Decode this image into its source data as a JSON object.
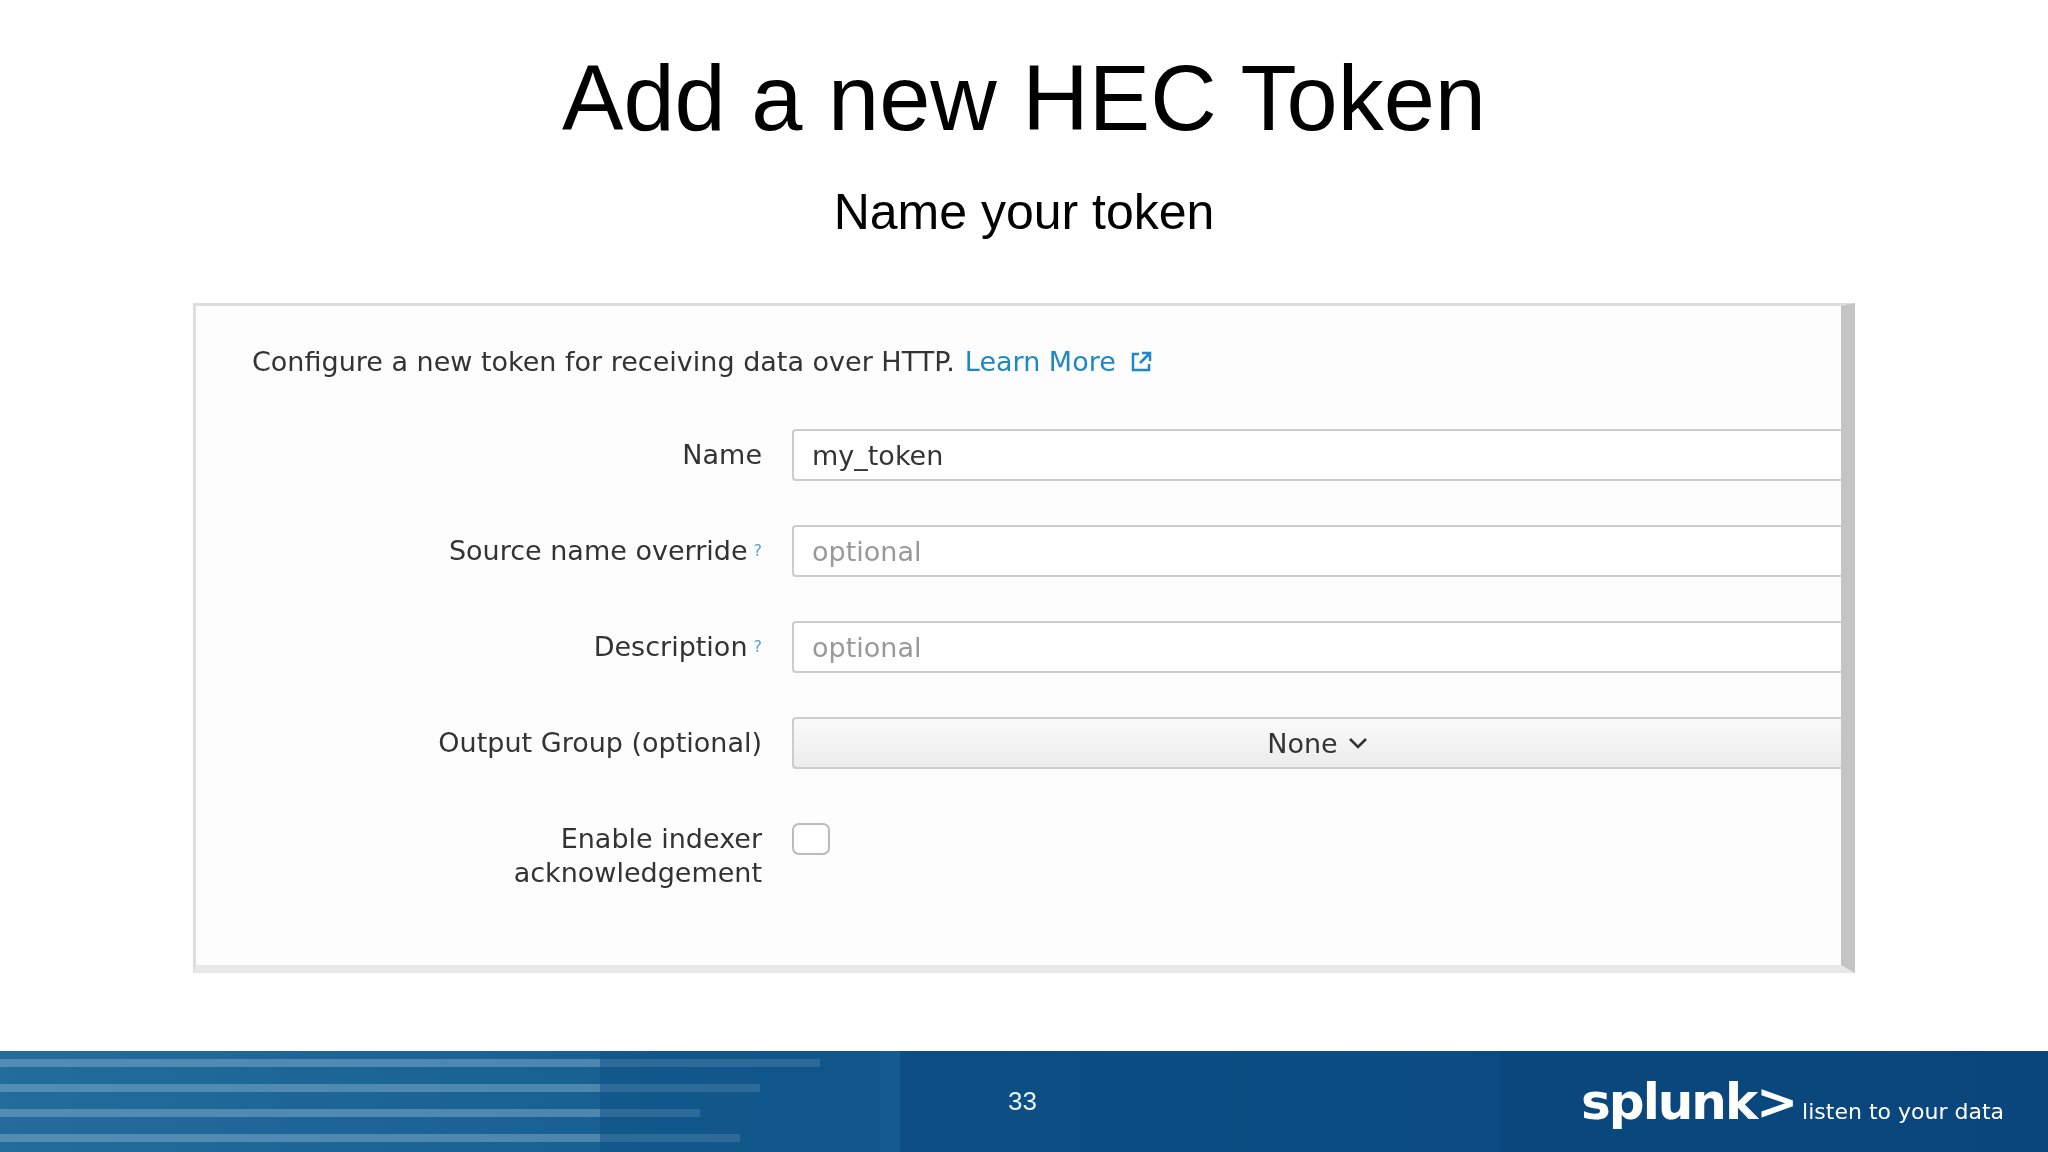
{
  "slide": {
    "title": "Add a new HEC Token",
    "subtitle": "Name your token"
  },
  "form": {
    "intro": "Configure a new token for receiving data over HTTP.",
    "link": "Learn More",
    "fields": [
      {
        "kind": "text",
        "label": "Name",
        "value": "my_token"
      },
      {
        "kind": "text",
        "label": "Source name override",
        "help": "?",
        "placeholder": "optional"
      },
      {
        "kind": "text",
        "label": "Description",
        "help": "?",
        "placeholder": "optional"
      },
      {
        "kind": "select",
        "label": "Output Group (optional)",
        "value": "None"
      },
      {
        "kind": "checkbox",
        "label": "Enable indexer acknowledgement",
        "checked": false
      }
    ]
  },
  "footer": {
    "page_number": "33",
    "logo": "splunk>",
    "tagline": "listen to your data"
  }
}
